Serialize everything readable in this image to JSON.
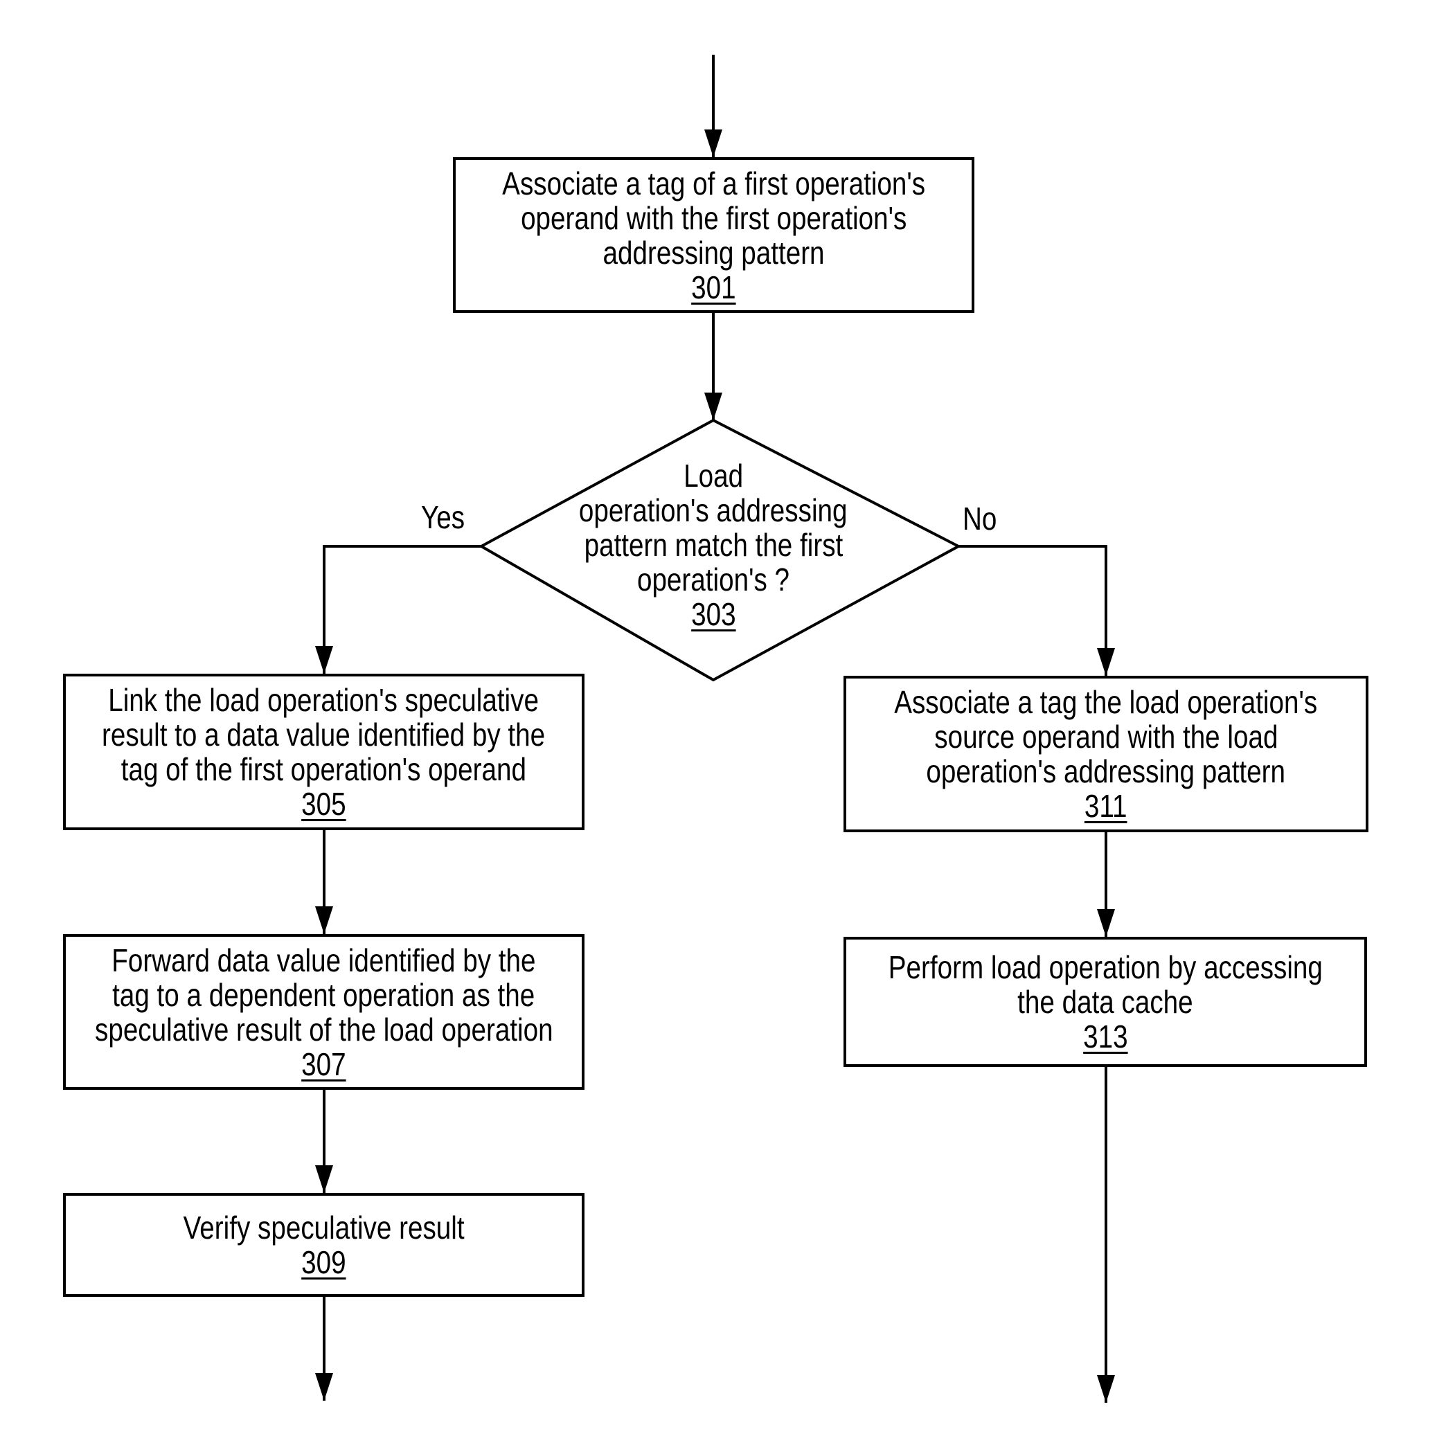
{
  "diagram": {
    "type": "flowchart",
    "colors": {
      "stroke": "#000000",
      "background": "#ffffff",
      "text": "#000000"
    },
    "entry_arrow": true,
    "nodes": {
      "n301": {
        "shape": "process",
        "lines": [
          "Associate a tag of a first operation's",
          "operand with the first operation's",
          "addressing pattern"
        ],
        "ref": "301"
      },
      "n303": {
        "shape": "decision",
        "lines": [
          "Load",
          "operation's addressing",
          "pattern match the first",
          "operation's ?"
        ],
        "ref": "303"
      },
      "n305": {
        "shape": "process",
        "lines": [
          "Link the load operation's speculative",
          "result to a data value identified by the",
          "tag of the first operation's operand"
        ],
        "ref": "305"
      },
      "n307": {
        "shape": "process",
        "lines": [
          "Forward data value identified by the",
          "tag to a dependent operation as the",
          "speculative result of the load operation"
        ],
        "ref": "307"
      },
      "n309": {
        "shape": "process",
        "lines": [
          "Verify speculative result"
        ],
        "ref": "309"
      },
      "n311": {
        "shape": "process",
        "lines": [
          "Associate a tag the load operation's",
          "source operand with the load",
          "operation's addressing pattern"
        ],
        "ref": "311"
      },
      "n313": {
        "shape": "process",
        "lines": [
          "Perform load operation by accessing",
          "the data cache"
        ],
        "ref": "313"
      }
    },
    "branch_labels": {
      "yes": "Yes",
      "no": "No"
    },
    "edges": [
      {
        "from": "entry",
        "to": "301"
      },
      {
        "from": "301",
        "to": "303"
      },
      {
        "from": "303",
        "to": "305",
        "label": "Yes"
      },
      {
        "from": "303",
        "to": "311",
        "label": "No"
      },
      {
        "from": "305",
        "to": "307"
      },
      {
        "from": "307",
        "to": "309"
      },
      {
        "from": "309",
        "to": "exit-left"
      },
      {
        "from": "311",
        "to": "313"
      },
      {
        "from": "313",
        "to": "exit-right"
      }
    ]
  }
}
